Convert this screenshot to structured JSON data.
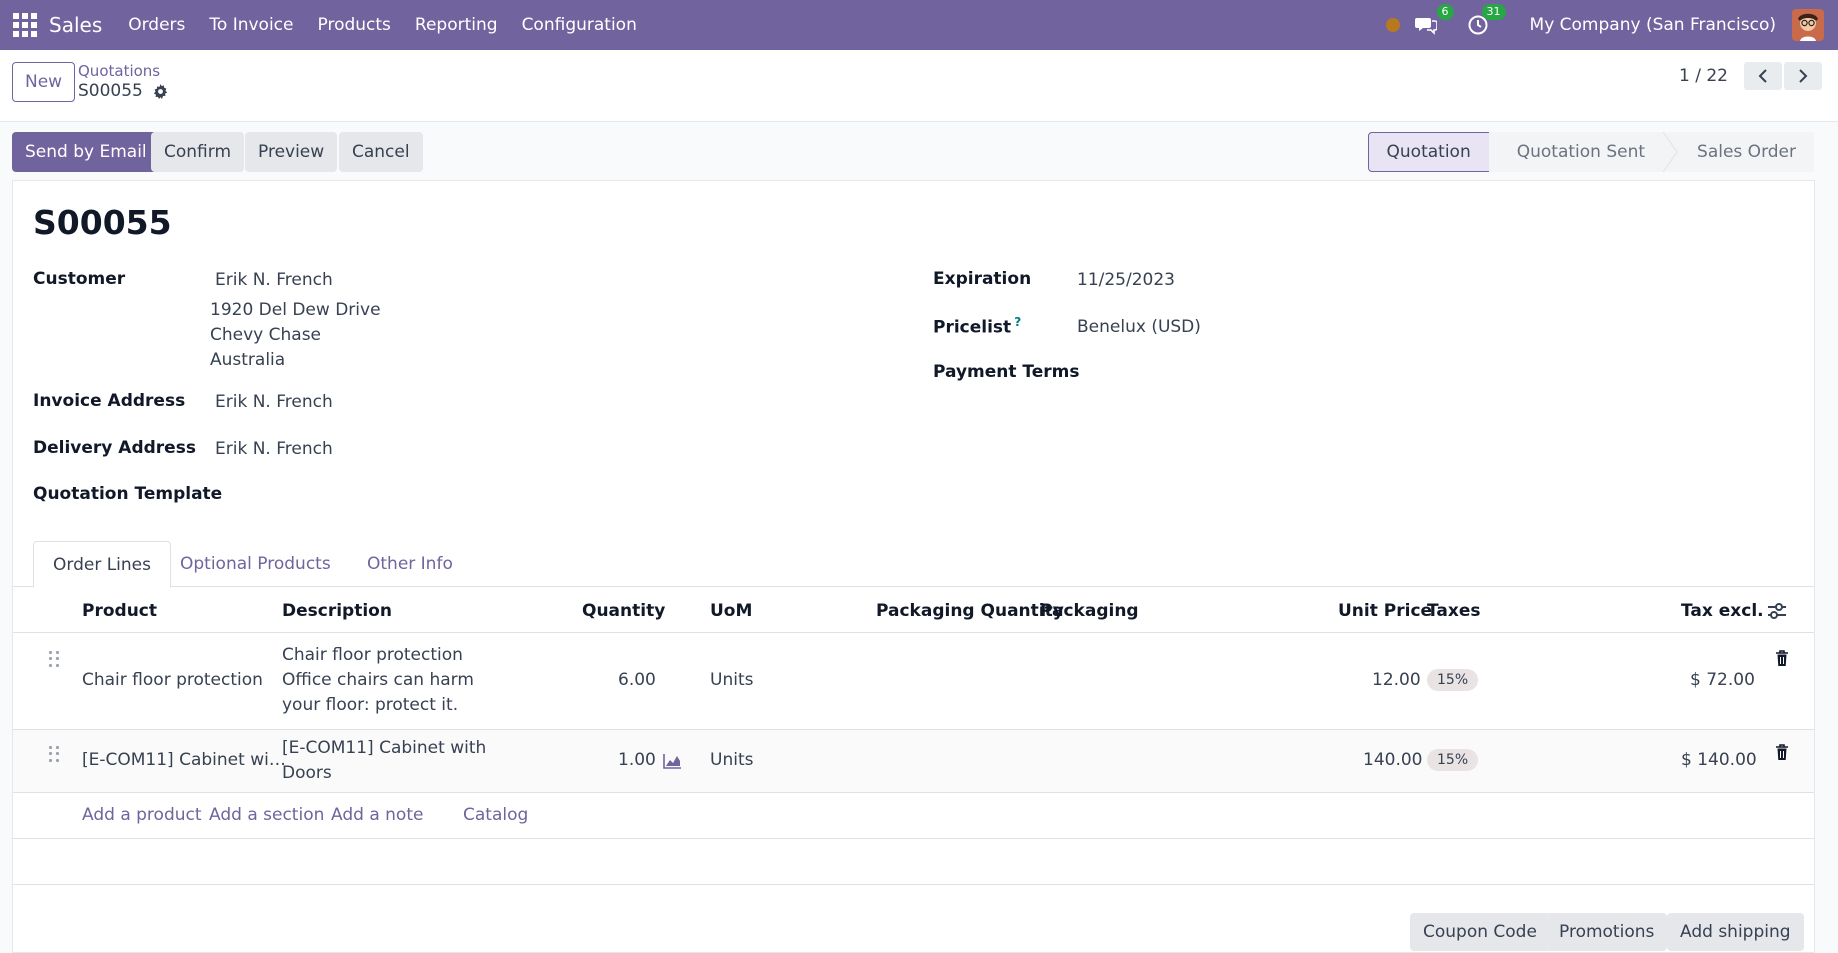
{
  "navbar": {
    "app_name": "Sales",
    "menu": [
      "Orders",
      "To Invoice",
      "Products",
      "Reporting",
      "Configuration"
    ],
    "messages_count": "6",
    "activities_count": "31",
    "company": "My Company (San Francisco)"
  },
  "control": {
    "new_label": "New",
    "breadcrumb_parent": "Quotations",
    "breadcrumb_current": "S00055",
    "pager": "1 / 22"
  },
  "actions": {
    "send_email": "Send by Email",
    "confirm": "Confirm",
    "preview": "Preview",
    "cancel": "Cancel"
  },
  "status": [
    "Quotation",
    "Quotation Sent",
    "Sales Order"
  ],
  "form": {
    "title": "S00055",
    "customer_label": "Customer",
    "customer_name": "Erik N. French",
    "customer_address": [
      "1920 Del Dew Drive",
      "Chevy Chase",
      "Australia"
    ],
    "invoice_label": "Invoice Address",
    "invoice_value": "Erik N. French",
    "delivery_label": "Delivery Address",
    "delivery_value": "Erik N. French",
    "template_label": "Quotation Template",
    "expiration_label": "Expiration",
    "expiration_value": "11/25/2023",
    "pricelist_label": "Pricelist",
    "pricelist_help": "?",
    "pricelist_value": "Benelux (USD)",
    "payment_terms_label": "Payment Terms"
  },
  "tabs": [
    "Order Lines",
    "Optional Products",
    "Other Info"
  ],
  "table": {
    "headers": {
      "product": "Product",
      "description": "Description",
      "quantity": "Quantity",
      "uom": "UoM",
      "packaging_qty": "Packaging Quantity",
      "packaging": "Packaging",
      "unit_price": "Unit Price",
      "taxes": "Taxes",
      "tax_excl": "Tax excl."
    },
    "rows": [
      {
        "product": "Chair floor protection",
        "description": [
          "Chair floor protection",
          "Office chairs can harm",
          "your floor: protect it."
        ],
        "quantity": "6.00",
        "uom": "Units",
        "unit_price": "12.00",
        "tax": "15%",
        "subtotal": "$ 72.00"
      },
      {
        "product": "[E-COM11] Cabinet wi…",
        "description": [
          "[E-COM11] Cabinet with",
          "Doors"
        ],
        "quantity": "1.00",
        "uom": "Units",
        "unit_price": "140.00",
        "tax": "15%",
        "subtotal": "$ 140.00"
      }
    ]
  },
  "add_links": [
    "Add a product",
    "Add a section",
    "Add a note",
    "Catalog"
  ],
  "bottom_buttons": [
    "Coupon Code",
    "Promotions",
    "Add shipping"
  ]
}
